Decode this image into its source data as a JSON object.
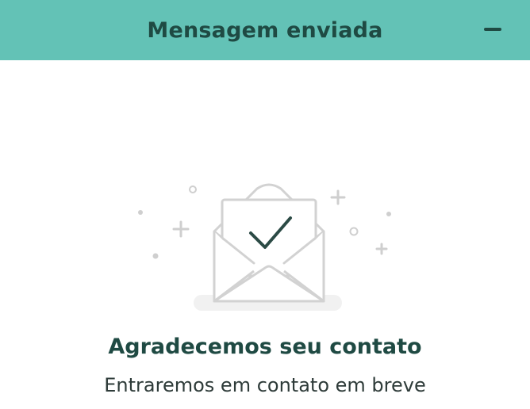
{
  "header": {
    "title": "Mensagem enviada",
    "minimize_icon": "minus-icon",
    "background": "#63c2b6",
    "text_color": "#1f4a43"
  },
  "illustration": {
    "icon": "envelope-check-icon"
  },
  "confirmation": {
    "title": "Agradecemos seu contato",
    "subtitle": "Entraremos em contato em breve"
  }
}
